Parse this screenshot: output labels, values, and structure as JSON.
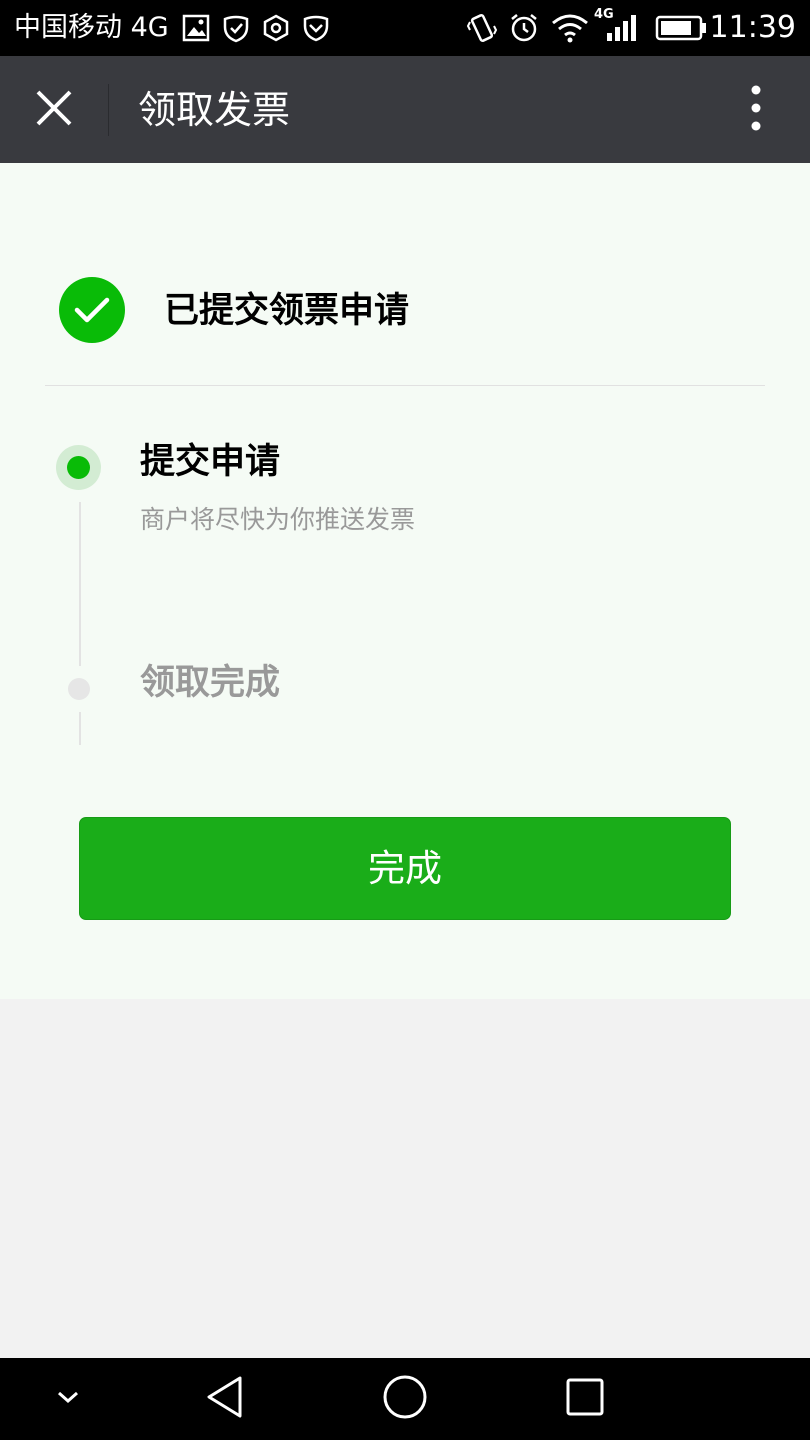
{
  "status_bar": {
    "carrier": "中国移动 4G",
    "network_label": "4G",
    "time": "11:39",
    "icons": [
      "image-icon",
      "shield-check-icon",
      "hexagon-icon",
      "shield-icon",
      "vibrate-icon",
      "alarm-icon",
      "wifi-icon",
      "signal-icon",
      "battery-icon"
    ]
  },
  "title_bar": {
    "title": "领取发票",
    "close_icon": "close-icon",
    "more_icon": "more-vertical-icon"
  },
  "result": {
    "icon": "check-circle-icon",
    "accent_color": "#09bb07",
    "text": "已提交领票申请"
  },
  "steps": [
    {
      "title": "提交申请",
      "description": "商户将尽快为你推送发票",
      "state": "active"
    },
    {
      "title": "领取完成",
      "state": "pending"
    }
  ],
  "actions": {
    "done_label": "完成",
    "button_color": "#1aad19"
  },
  "nav_bar": {
    "icons": [
      "chevron-down-icon",
      "back-icon",
      "home-icon",
      "recents-icon"
    ]
  }
}
